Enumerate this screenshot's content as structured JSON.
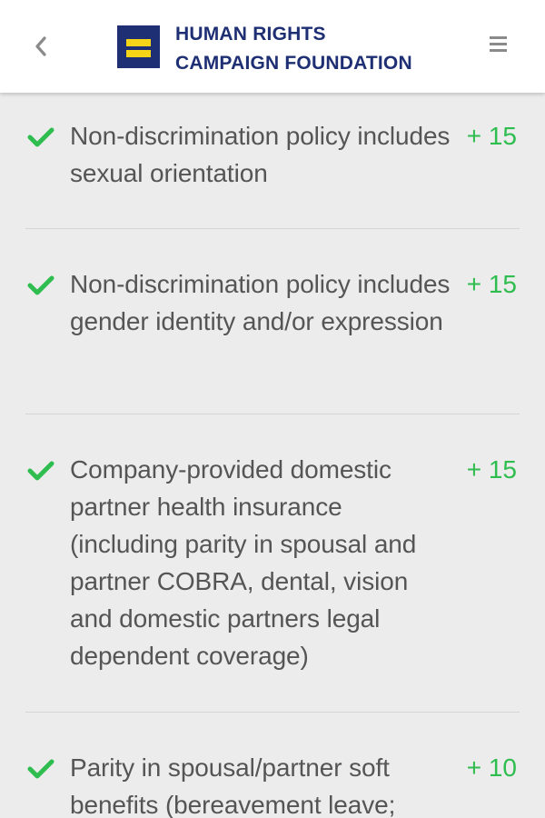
{
  "header": {
    "org_name_line1": "HUMAN RIGHTS",
    "org_name_line2": "CAMPAIGN FOUNDATION",
    "logo_color": "#1f2f73",
    "logo_accent": "#f6d417",
    "back_icon": "chevron-left-icon",
    "menu_icon": "hamburger-menu-icon"
  },
  "colors": {
    "check": "#2ebd4e",
    "points": "#2ebd4e",
    "text": "#555555",
    "background": "#ececec"
  },
  "criteria": [
    {
      "text": "Non-discrimination policy includes sexual orientation",
      "points": "+ 15",
      "met": true
    },
    {
      "text": "Non-discrimination policy includes gender identity and/or expression",
      "points": "+ 15",
      "met": true
    },
    {
      "text": "Company-provided domestic partner health insurance (including parity in spousal and partner COBRA, dental, vision and domestic partners legal dependent coverage)",
      "points": "+ 15",
      "met": true
    },
    {
      "text": "Parity in spousal/partner soft benefits (bereavement leave;",
      "points": "+ 10",
      "met": true
    }
  ]
}
